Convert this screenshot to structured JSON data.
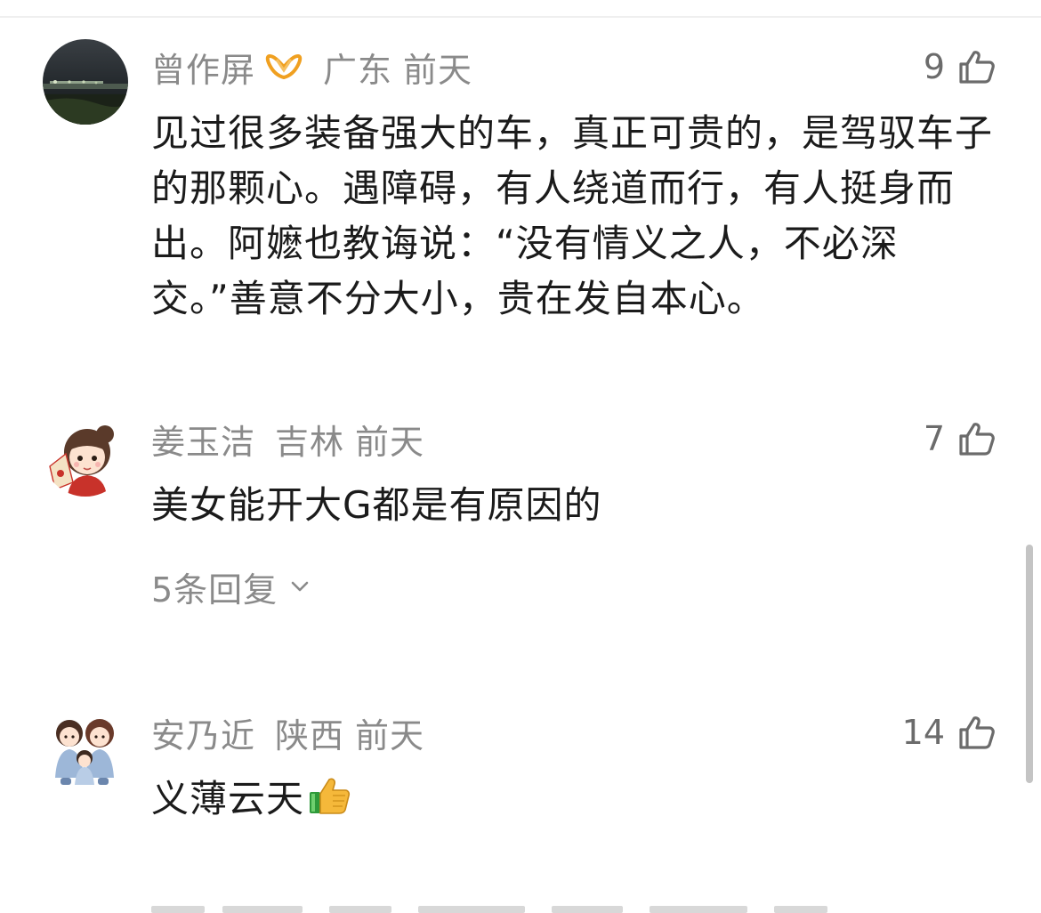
{
  "comments": [
    {
      "author": "曾作屏",
      "region": "广东",
      "time": "前天",
      "likes": "9",
      "text": "见过很多装备强大的车，真正可贵的，是驾驭车子的那颗心。遇障碍，有人绕道而行，有人挺身而出。阿嬷也教诲说：“没有情义之人，不必深交。”善意不分大小，贵在发自本心。",
      "avatar_icon": "night-city-avatar",
      "badge_icon": "vip-badge-icon"
    },
    {
      "author": "姜玉洁",
      "region": "吉林",
      "time": "前天",
      "likes": "7",
      "text": "美女能开大G都是有原因的",
      "replies_label": "5条回复",
      "avatar_icon": "cartoon-girl-avatar"
    },
    {
      "author": "安乃近",
      "region": "陕西",
      "time": "前天",
      "likes": "14",
      "text": "义薄云天",
      "avatar_icon": "cartoon-family-avatar",
      "emoji_icon": "thumbs-up-emoji"
    }
  ],
  "colors": {
    "meta": "#8a8a8a",
    "text": "#1b1b1b",
    "vip": "#f0a020",
    "like_icon": "#6b6b6b"
  }
}
